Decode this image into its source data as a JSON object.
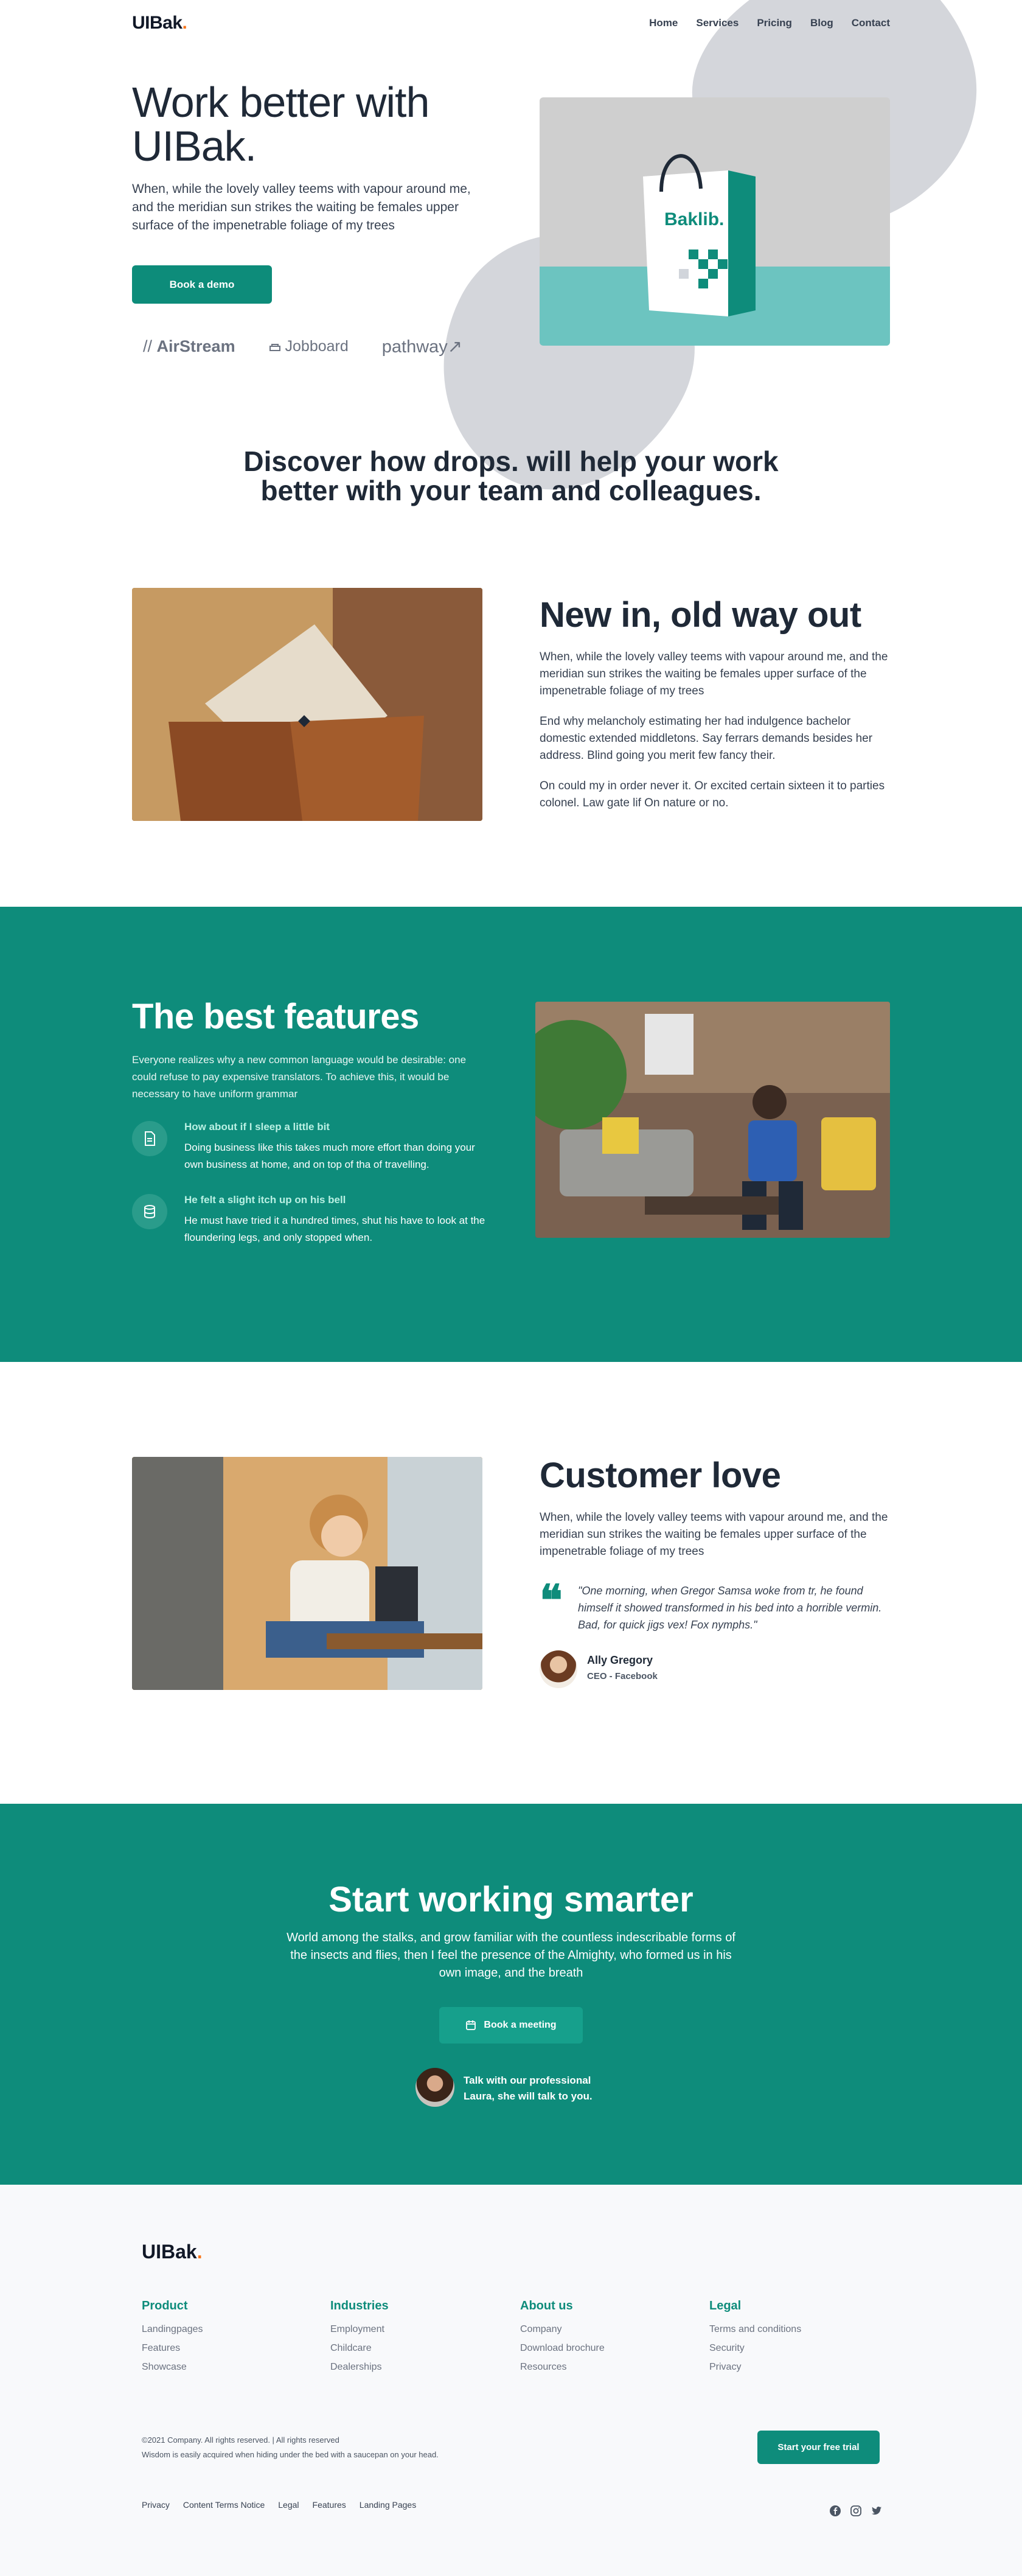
{
  "header": {
    "logo": "UIBak",
    "logo_dot": ".",
    "nav": [
      "Home",
      "Services",
      "Pricing",
      "Blog",
      "Contact"
    ]
  },
  "hero": {
    "title": "Work better with UIBak.",
    "text": "When, while the lovely valley teems with vapour around me, and the meridian sun strikes the waiting be females upper surface of the impenetrable foliage of my trees",
    "cta": "Book a demo",
    "partners": [
      "AirStream",
      "Jobboard",
      "pathway"
    ],
    "bag_brand": "Baklib."
  },
  "discover": {
    "title": "Discover how drops. will help your work better with your team and colleagues."
  },
  "feature_one": {
    "title": "New in, old way out",
    "paragraphs": [
      "When, while the lovely valley teems with vapour around me, and the meridian sun strikes the waiting be females upper surface of the impenetrable foliage of my trees",
      "End why melancholy estimating her had indulgence bachelor domestic extended middletons. Say ferrars demands besides her address. Blind going you merit few fancy their.",
      "On could my in order never it. Or excited certain sixteen it to parties colonel. Law gate lif On nature or no."
    ]
  },
  "features": {
    "title": "The best features",
    "text": "Everyone realizes why a new common language would be desirable: one could refuse to pay expensive translators. To achieve this, it would be necessary to have uniform grammar",
    "items": [
      {
        "icon": "document-icon",
        "heading": "How about if I sleep a little bit",
        "body": "Doing business like this takes much more effort than doing your own business at home, and on top of tha of travelling."
      },
      {
        "icon": "database-icon",
        "heading": "He felt a slight itch up on his bell",
        "body": "He must have tried it a hundred times, shut his have to look at the floundering legs, and only stopped when."
      }
    ]
  },
  "customer_love": {
    "title": "Customer love",
    "text": "When, while the lovely valley teems with vapour around me, and the meridian sun strikes the waiting be females upper surface of the impenetrable foliage of my trees",
    "quote": "\"One morning, when Gregor Samsa woke from tr, he found himself it showed transformed in his bed into a horrible vermin. Bad, for quick jigs vex! Fox nymphs.\"",
    "author_name": "Ally Gregory",
    "author_role": "CEO - Facebook"
  },
  "cta": {
    "title": "Start working smarter",
    "text": "World among the stalks, and grow familiar with the countless indescribable forms of the insects and flies, then I feel the presence of the Almighty, who formed us in his own image, and the breath",
    "button": "Book a meeting",
    "talk": "Talk with our professional Laura, she will talk to you."
  },
  "footer": {
    "logo": "UIBak",
    "columns": [
      {
        "title": "Product",
        "links": [
          "Landingpages",
          "Features",
          "Showcase"
        ]
      },
      {
        "title": "Industries",
        "links": [
          "Employment",
          "Childcare",
          "Dealerships"
        ]
      },
      {
        "title": "About us",
        "links": [
          "Company",
          "Download brochure",
          "Resources"
        ]
      },
      {
        "title": "Legal",
        "links": [
          "Terms and conditions",
          "Security",
          "Privacy"
        ]
      }
    ],
    "copyright": "©2021 Company. All rights reserved. | All rights reserved",
    "tagline": "Wisdom is easily acquired when hiding under the bed with a saucepan on your head.",
    "trial_button": "Start your free trial",
    "bottom_links": [
      "Privacy",
      "Content Terms Notice",
      "Legal",
      "Features",
      "Landing Pages"
    ],
    "socials": [
      "facebook-icon",
      "instagram-icon",
      "twitter-icon"
    ]
  },
  "colors": {
    "brand_green": "#0e8c7b",
    "accent_orange": "#f97316",
    "blob_gray": "#d4d6db"
  }
}
